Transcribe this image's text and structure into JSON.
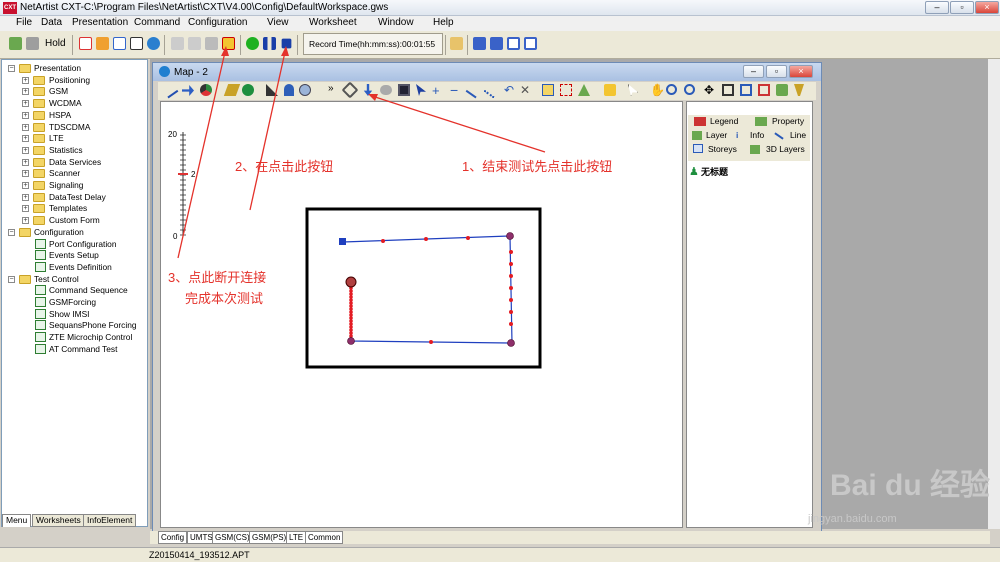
{
  "window": {
    "title": "NetArtist CXT-C:\\Program Files\\NetArtist\\CXT\\V4.00\\Config\\DefaultWorkspace.gws",
    "icon_text": "CXT",
    "controls": [
      "–",
      "▫",
      "×"
    ]
  },
  "menu": [
    "File",
    "Data",
    "Presentation",
    "Command",
    "Configuration",
    "View",
    "Worksheet",
    "Window",
    "Help"
  ],
  "toolbar": {
    "hold": "Hold",
    "record_time": "Record Time(hh:mm:ss):00:01:55"
  },
  "tree": {
    "presentation": {
      "label": "Presentation",
      "children": [
        "Positioning",
        "GSM",
        "WCDMA",
        "HSPA",
        "TDSCDMA",
        "LTE",
        "Statistics",
        "Data Services",
        "Scanner",
        "Signaling",
        "DataTest Delay",
        "Templates",
        "Custom Form"
      ]
    },
    "configuration": {
      "label": "Configuration",
      "children": [
        "Port Configuration",
        "Events Setup",
        "Events Definition"
      ]
    },
    "test_control": {
      "label": "Test Control",
      "children": [
        "Command Sequence",
        "GSMForcing",
        "Show IMSI",
        "SequansPhone Forcing",
        "ZTE Microchip Control",
        "AT Command Test"
      ]
    }
  },
  "left_tabs": [
    "Menu",
    "Worksheets",
    "InfoElement"
  ],
  "map": {
    "title": "Map - 2",
    "scale_top": "20",
    "scale_mid": "2",
    "scale_bottom": "0",
    "more": "»"
  },
  "right_panel": {
    "tabs_row1": [
      "Legend",
      "Property"
    ],
    "tabs_row2": [
      "Layer",
      "Info",
      "Line"
    ],
    "tabs_row3": [
      "Storeys",
      "3D Layers"
    ],
    "layer_item": "无标题"
  },
  "bottom_tabs": [
    "Config",
    "UMTS",
    "GSM(CS)",
    "GSM(PS)",
    "LTE",
    "Common"
  ],
  "status": {
    "file": "Z20150414_193512.APT"
  },
  "annotations": {
    "a1": "1、结束测试先点击此按钮",
    "a2": "2、在点击此按钮",
    "a3_line1": "3、点此断开连接",
    "a3_line2": "完成本次测试"
  },
  "watermark": {
    "brand": "Bai du 经验",
    "url": "jingyan.baidu.com"
  },
  "colors": {
    "route": "#1f3fbf",
    "point": "#e31b23",
    "annotation": "#e4322b"
  }
}
